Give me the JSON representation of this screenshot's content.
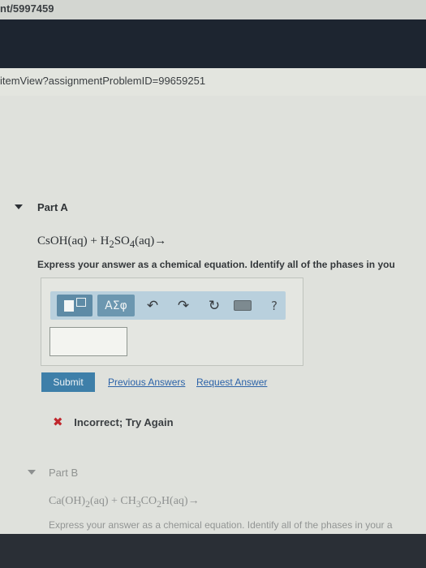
{
  "browser": {
    "url_top": "nt/5997459",
    "url_main": "itemView?assignmentProblemID=99659251"
  },
  "partA": {
    "title": "Part A",
    "equation_html": "CsOH(aq) + H<sub>2</sub>SO<sub>4</sub>(aq)→",
    "instruction": "Express your answer as a chemical equation. Identify all of the phases in you",
    "toolbar": {
      "greek_label": "ΑΣφ",
      "undo_icon": "undo-icon",
      "redo_icon": "redo-icon",
      "reset_icon": "reset-icon",
      "keyboard_icon": "keyboard-icon",
      "help_label": "?"
    },
    "answer_value": "",
    "submit_label": "Submit",
    "previous_answers_label": "Previous Answers",
    "request_answer_label": "Request Answer",
    "feedback_mark": "✖",
    "feedback_text": "Incorrect; Try Again"
  },
  "partB": {
    "title": "Part B",
    "equation_html": "Ca(OH)<sub>2</sub>(aq) + CH<sub>3</sub>CO<sub>2</sub>H(aq)→",
    "instruction": "Express your answer as a chemical equation. Identify all of the phases in your a"
  },
  "colors": {
    "submit": "#3e7fa9",
    "toolbar": "#b9d0dd",
    "incorrect": "#c0272d",
    "link": "#2c63a8"
  }
}
